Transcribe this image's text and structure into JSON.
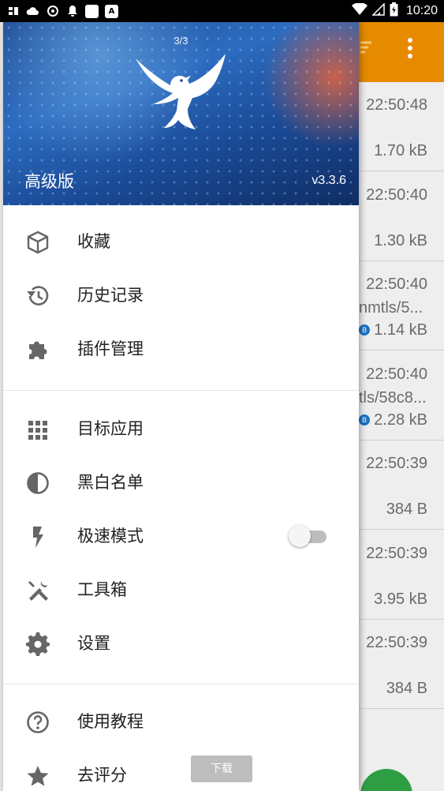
{
  "status_bar": {
    "time": "10:20",
    "left_icons": [
      "app-icon",
      "cloud-icon",
      "target-icon",
      "bell-icon",
      "square-icon",
      "a-icon"
    ],
    "right_icons": [
      "wifi-icon",
      "signal-icon",
      "battery-icon"
    ]
  },
  "drawer": {
    "header": {
      "counter": "3/3",
      "edition": "高级版",
      "version": "v3.3.6"
    },
    "sections": [
      [
        {
          "label": "收藏",
          "icon": "cube-icon"
        },
        {
          "label": "历史记录",
          "icon": "history-icon"
        },
        {
          "label": "插件管理",
          "icon": "puzzle-icon"
        }
      ],
      [
        {
          "label": "目标应用",
          "icon": "apps-grid-icon"
        },
        {
          "label": "黑白名单",
          "icon": "contrast-icon"
        },
        {
          "label": "极速模式",
          "icon": "flash-icon",
          "toggle": false
        },
        {
          "label": "工具箱",
          "icon": "tools-icon"
        },
        {
          "label": "设置",
          "icon": "gear-icon"
        }
      ],
      [
        {
          "label": "使用教程",
          "icon": "help-icon"
        },
        {
          "label": "去评分",
          "icon": "star-icon"
        }
      ]
    ]
  },
  "background_list": {
    "rows": [
      {
        "time": "22:50:48",
        "size": "1.70 kB",
        "path": ""
      },
      {
        "time": "22:50:40",
        "size": "1.30 kB",
        "path": ""
      },
      {
        "time": "22:50:40",
        "size": "1.14 kB",
        "path": "nmtls/5...",
        "badge": "B"
      },
      {
        "time": "22:50:40",
        "size": "2.28 kB",
        "path": "tls/58c8...",
        "badge": "B"
      },
      {
        "time": "22:50:39",
        "size": "384 B",
        "path": ""
      },
      {
        "time": "22:50:39",
        "size": "3.95 kB",
        "path": ""
      },
      {
        "time": "22:50:39",
        "size": "384 B",
        "path": ""
      }
    ]
  },
  "toast": {
    "text": "下载"
  },
  "colors": {
    "toolbar": "#e68a00",
    "fab": "#2e9e43",
    "header": "#1e4c93"
  }
}
